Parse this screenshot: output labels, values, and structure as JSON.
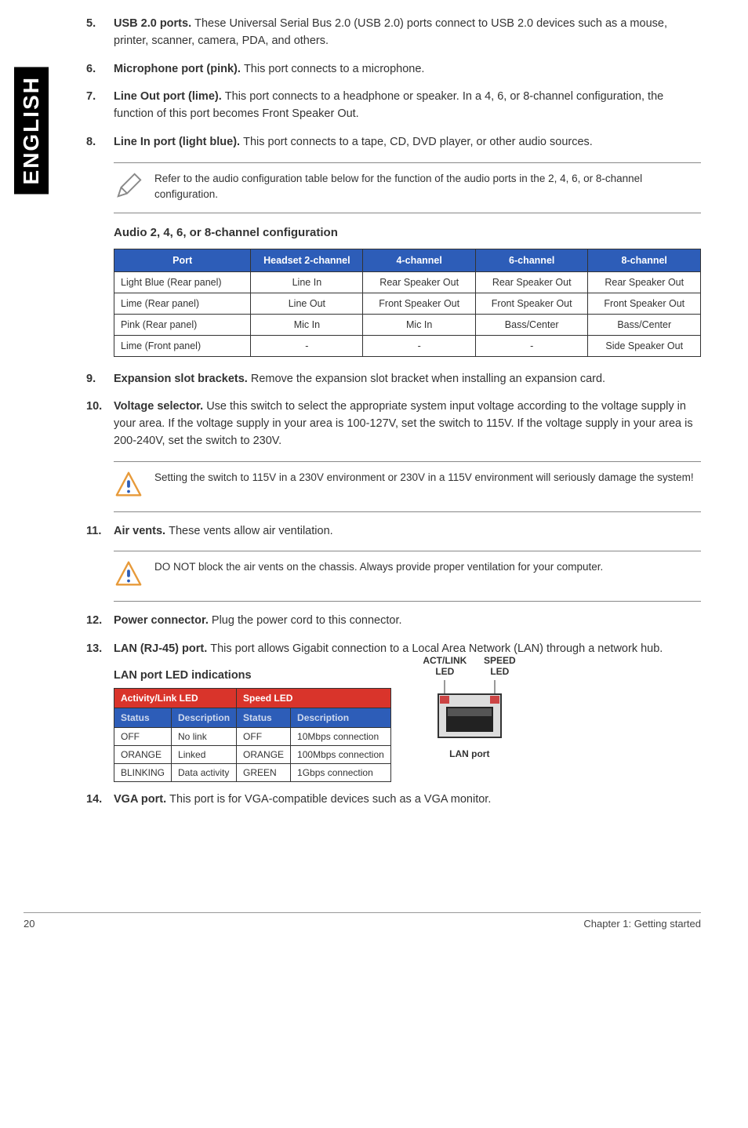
{
  "sidebar_label": "ENGLISH",
  "items": [
    {
      "num": "5.",
      "bold": "USB 2.0 ports. ",
      "text": "These Universal Serial Bus 2.0 (USB 2.0) ports connect to USB 2.0 devices such as a mouse, printer, scanner, camera, PDA, and others."
    },
    {
      "num": "6.",
      "bold": "Microphone port (pink). ",
      "text": "This port connects to a microphone."
    },
    {
      "num": "7.",
      "bold": "Line Out port (lime). ",
      "text": "This port connects to a headphone or speaker. In a 4, 6, or 8-channel configuration, the function of this port becomes Front Speaker Out."
    },
    {
      "num": "8.",
      "bold": "Line In port (light blue). ",
      "text": "This port connects to a tape, CD, DVD player, or other audio sources."
    }
  ],
  "note1": "Refer to the audio configuration table below for the function of the audio ports in the 2, 4, 6, or 8-channel configuration.",
  "audio_heading": "Audio 2, 4, 6, or 8-channel configuration",
  "audio_table": {
    "headers": [
      "Port",
      "Headset 2-channel",
      "4-channel",
      "6-channel",
      "8-channel"
    ],
    "rows": [
      [
        "Light Blue (Rear panel)",
        "Line In",
        "Rear Speaker Out",
        "Rear Speaker Out",
        "Rear Speaker Out"
      ],
      [
        "Lime (Rear panel)",
        "Line Out",
        "Front Speaker Out",
        "Front Speaker Out",
        "Front Speaker Out"
      ],
      [
        "Pink (Rear panel)",
        "Mic In",
        "Mic In",
        "Bass/Center",
        "Bass/Center"
      ],
      [
        "Lime (Front panel)",
        "-",
        "-",
        "-",
        "Side Speaker Out"
      ]
    ]
  },
  "items2": [
    {
      "num": "9.",
      "bold": "Expansion slot brackets. ",
      "text": "Remove the expansion slot bracket when installing an expansion card."
    },
    {
      "num": "10.",
      "bold": "Voltage selector. ",
      "text": "Use this switch to select the appropriate system input voltage according to the voltage supply in your area. If the voltage supply in your area is 100-127V, set the switch to 115V. If the voltage supply in your area is 200-240V, set the switch to 230V."
    }
  ],
  "note2": "Setting the switch to 115V in a 230V environment or 230V in a 115V environment will seriously damage the system!",
  "items3": [
    {
      "num": "11.",
      "bold": "Air vents. ",
      "text": "These vents allow air ventilation."
    }
  ],
  "note3": "DO NOT block the air vents on the chassis. Always provide proper ventilation for your computer.",
  "items4": [
    {
      "num": "12.",
      "bold": "Power connector. ",
      "text": "Plug the power cord to this connector."
    },
    {
      "num": "13.",
      "bold": "LAN (RJ-45) port. ",
      "text": "This port allows Gigabit connection to a Local Area Network (LAN) through a network hub."
    }
  ],
  "lan_heading": "LAN port LED indications",
  "lan_table": {
    "group_headers": [
      "Activity/Link LED",
      "Speed LED"
    ],
    "sub_headers": [
      "Status",
      "Description",
      "Status",
      "Description"
    ],
    "rows": [
      [
        "OFF",
        "No link",
        "OFF",
        "10Mbps connection"
      ],
      [
        "ORANGE",
        "Linked",
        "ORANGE",
        "100Mbps connection"
      ],
      [
        "BLINKING",
        "Data activity",
        "GREEN",
        "1Gbps connection"
      ]
    ]
  },
  "lan_labels": {
    "left": "ACT/LINK LED",
    "right": "SPEED LED"
  },
  "lan_port_caption": "LAN port",
  "items5": [
    {
      "num": "14.",
      "bold": "VGA port. ",
      "text": "This port is for VGA-compatible devices such as a VGA monitor."
    }
  ],
  "footer": {
    "page": "20",
    "chapter": "Chapter 1: Getting started"
  }
}
